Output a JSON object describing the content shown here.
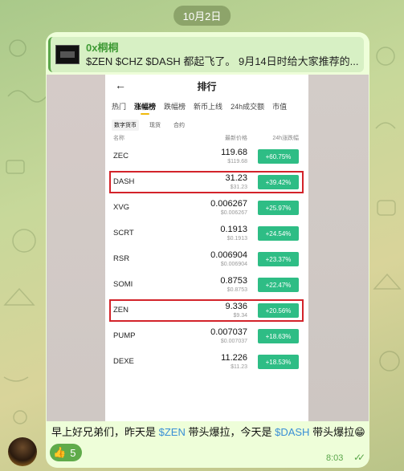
{
  "date_pill": "10月2日",
  "reply": {
    "author": "0x桐桐",
    "text": "$ZEN $CHZ $DASH 都起飞了。 9月14日时给大家推荐的..."
  },
  "screenshot": {
    "title": "排行",
    "tabs": [
      "热门",
      "涨幅榜",
      "跌幅榜",
      "新币上线",
      "24h成交额",
      "市值"
    ],
    "active_tab": "涨幅榜",
    "subtabs": [
      "数字货币",
      "现货",
      "合约"
    ],
    "col_name": "名称",
    "col_price": "最新价格",
    "col_change": "24h涨跌幅",
    "rows": [
      {
        "symbol": "ZEC",
        "price": "119.68",
        "usd": "$119.68",
        "change": "+60.75%"
      },
      {
        "symbol": "DASH",
        "price": "31.23",
        "usd": "$31.23",
        "change": "+39.42%"
      },
      {
        "symbol": "XVG",
        "price": "0.006267",
        "usd": "$0.006267",
        "change": "+25.97%"
      },
      {
        "symbol": "SCRT",
        "price": "0.1913",
        "usd": "$0.1913",
        "change": "+24.54%"
      },
      {
        "symbol": "RSR",
        "price": "0.006904",
        "usd": "$0.006904",
        "change": "+23.37%"
      },
      {
        "symbol": "SOMI",
        "price": "0.8753",
        "usd": "$0.8753",
        "change": "+22.47%"
      },
      {
        "symbol": "ZEN",
        "price": "9.336",
        "usd": "$9.34",
        "change": "+20.56%"
      },
      {
        "symbol": "PUMP",
        "price": "0.007037",
        "usd": "$0.007037",
        "change": "+18.63%"
      },
      {
        "symbol": "DEXE",
        "price": "11.226",
        "usd": "$11.23",
        "change": "+18.53%"
      }
    ],
    "highlighted": [
      "DASH",
      "ZEN"
    ]
  },
  "caption": {
    "part1": "早上好兄弟们，昨天是 ",
    "tag1": "$ZEN",
    "part2": " 带头爆拉，今天是 ",
    "tag2": "$DASH",
    "part3": " 带头爆拉",
    "emoji": "😁"
  },
  "reaction": {
    "emoji": "👍",
    "count": "5"
  },
  "time": "8:03",
  "read_checks": "✓✓",
  "colors": {
    "accent_green": "#5fab4a",
    "change_green": "#2ebd85",
    "highlight_red": "#d3232a",
    "link_blue": "#3a8fd6"
  }
}
